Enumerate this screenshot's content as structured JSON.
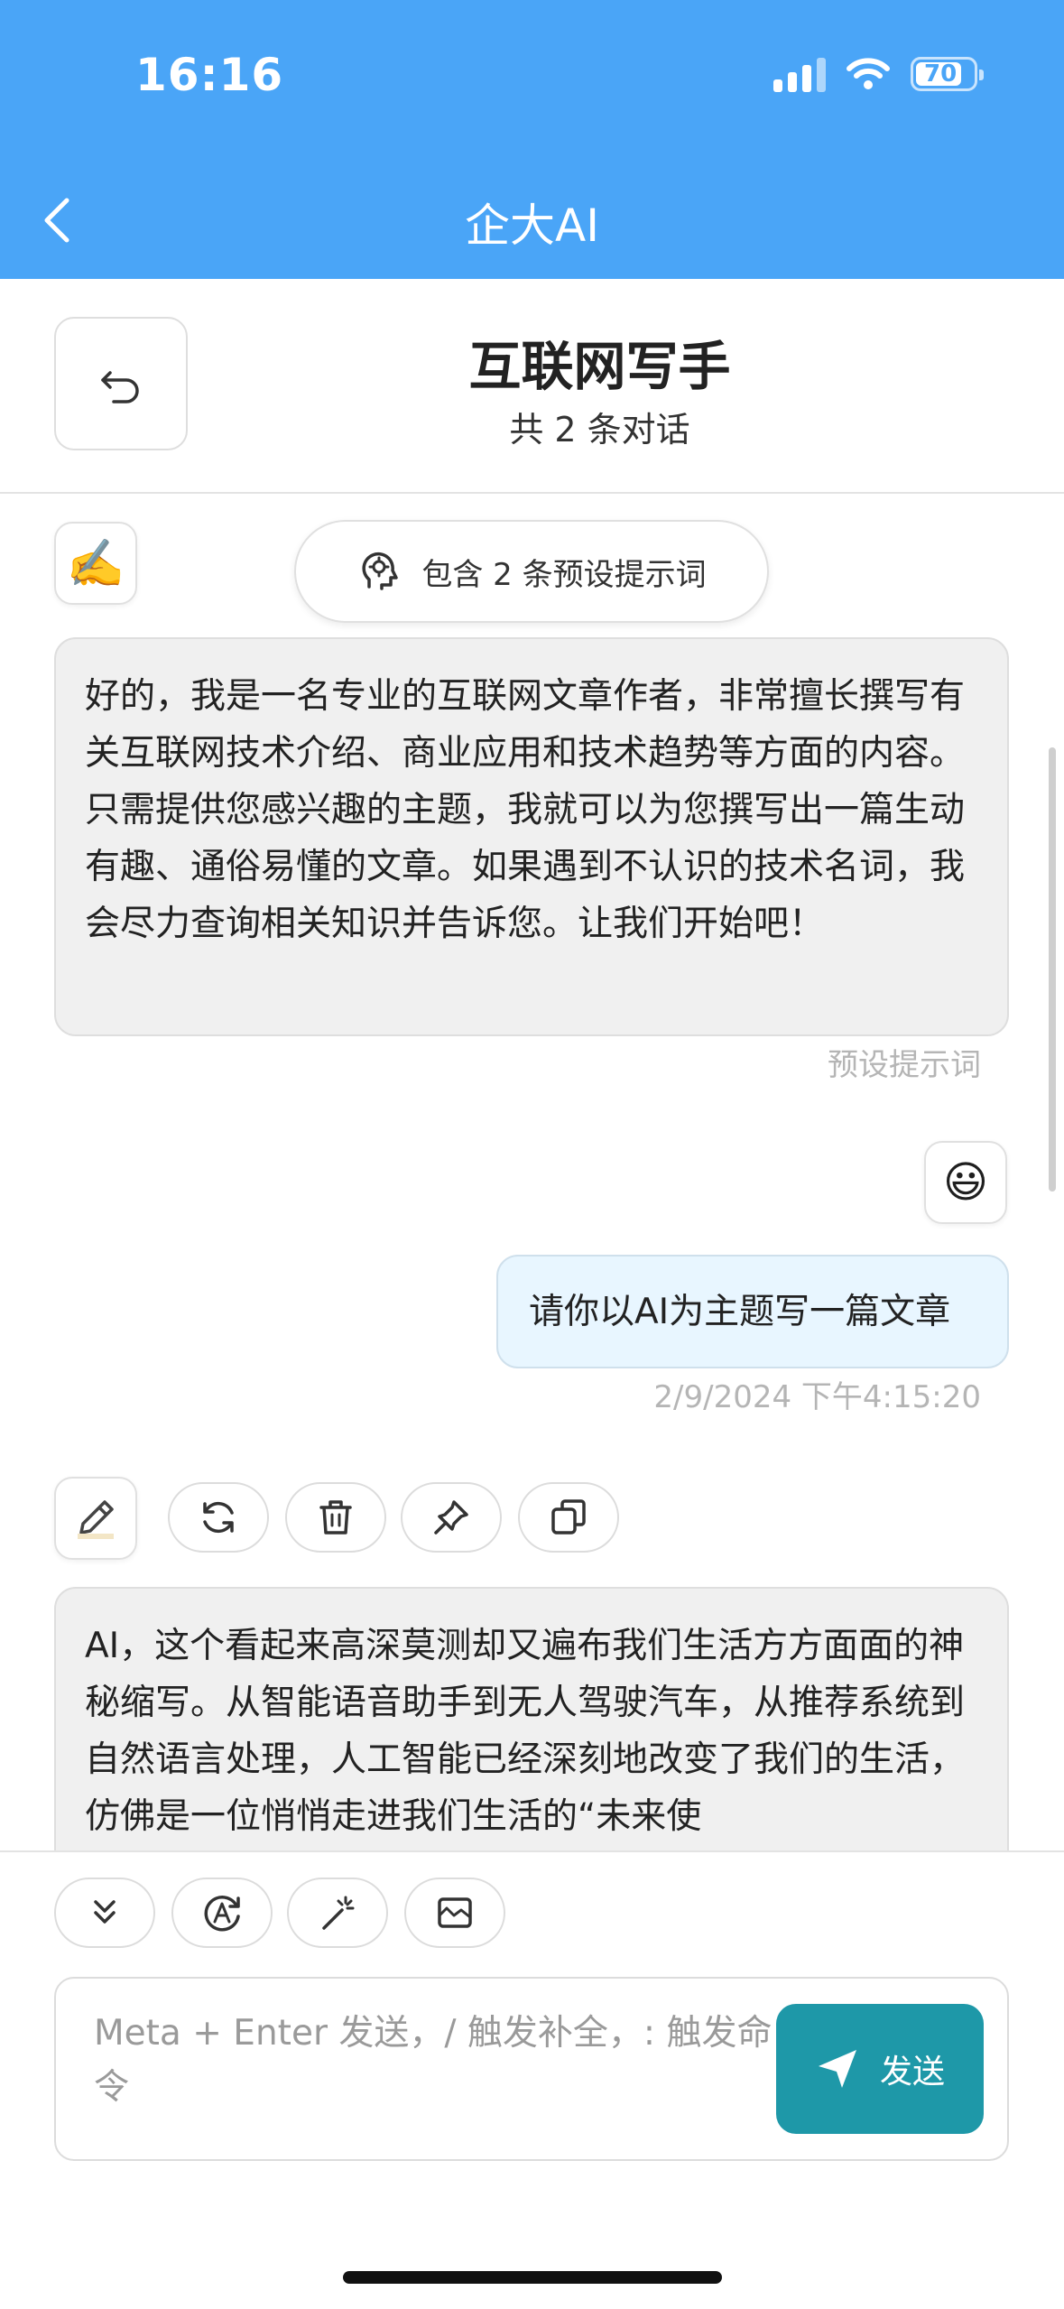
{
  "status_bar": {
    "time": "16:16",
    "battery": "70"
  },
  "nav": {
    "title": "企大AI"
  },
  "chat_header": {
    "title": "互联网写手",
    "subtitle": "共 2 条对话"
  },
  "prompt_chip": {
    "label": "包含 2 条预设提示词"
  },
  "messages": [
    {
      "role": "assistant",
      "avatar": "✍️",
      "text": "好的，我是一名专业的互联网文章作者，非常擅长撰写有关互联网技术介绍、商业应用和技术趋势等方面的内容。只需提供您感兴趣的主题，我就可以为您撰写出一篇生动有趣、通俗易懂的文章。如果遇到不认识的技术名词，我会尽力查询相关知识并告诉您。让我们开始吧！",
      "meta": "预设提示词"
    },
    {
      "role": "user",
      "avatar": "😃",
      "text": "请你以AI为主题写一篇文章",
      "meta": "2/9/2024 下午4:15:20"
    },
    {
      "role": "assistant",
      "avatar": "✏️",
      "text": "AI，这个看起来高深莫测却又遍布我们生活方方面面的神秘缩写。从智能语音助手到无人驾驶汽车，从推荐系统到自然语言处理，人工智能已经深刻地改变了我们的生活，仿佛是一位悄悄走进我们生活的“未来使"
    }
  ],
  "message_actions": [
    "edit-icon",
    "refresh-icon",
    "delete-icon",
    "pin-icon",
    "copy-icon"
  ],
  "input": {
    "placeholder": "Meta + Enter 发送，/ 触发补全，: 触发命令",
    "send_label": "发送"
  },
  "colors": {
    "header_blue": "#4aa5f7",
    "send_teal": "#1e98a8",
    "user_bubble": "#e8f6ff",
    "bot_bubble": "#f0f0f0"
  }
}
